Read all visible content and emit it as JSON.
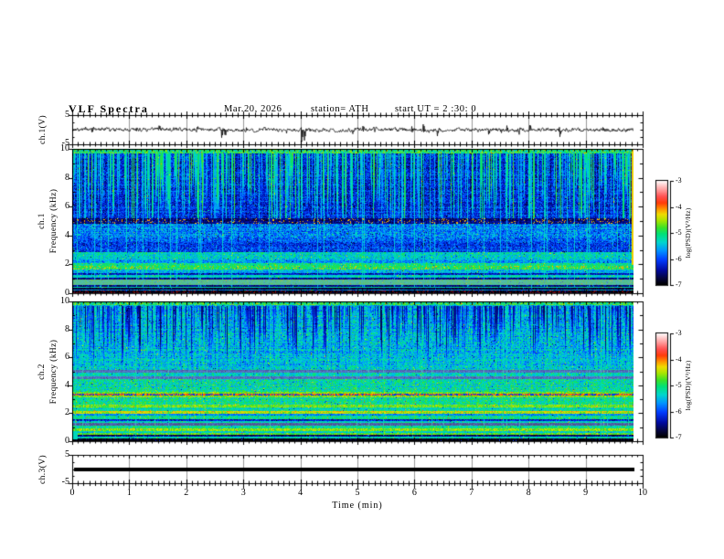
{
  "title": {
    "main": "VLF  Spectra",
    "date": "Mar.20, 2026",
    "station": "station= ATH",
    "start_ut": "start UT =  2 :30: 0"
  },
  "axes": {
    "time": {
      "label": "Time  (min)",
      "ticks": [
        "0",
        "1",
        "2",
        "3",
        "4",
        "5",
        "6",
        "7",
        "8",
        "9",
        "10"
      ],
      "range": [
        0,
        10
      ]
    },
    "ch1_wave": {
      "label": "ch.1(V)",
      "ticks": [
        "5",
        "-5"
      ],
      "range": [
        -5,
        5
      ]
    },
    "spec1": {
      "label_ch": "ch.1",
      "label_freq": "Frequency  (kHz)",
      "ticks": [
        "10",
        "8",
        "6",
        "4",
        "2",
        "0"
      ],
      "range": [
        0,
        10
      ]
    },
    "spec2": {
      "label_ch": "ch.2",
      "label_freq": "Frequency  (kHz)",
      "ticks": [
        "10",
        "8",
        "6",
        "4",
        "2",
        "0"
      ],
      "range": [
        0,
        10
      ]
    },
    "ch3_wave": {
      "label": "ch.3(V)",
      "ticks": [
        "5",
        "-5"
      ],
      "range": [
        -5,
        5
      ]
    }
  },
  "colorbar": {
    "label": "log(PSD)(V²/Hz)",
    "ticks": [
      "-3",
      "-4",
      "-5",
      "-6",
      "-7"
    ],
    "range": [
      -7,
      -3
    ]
  },
  "chart_data": {
    "type": "heatmap",
    "title": "VLF Spectra",
    "date": "Mar.20, 2026",
    "station": "ATH",
    "start_ut": "2:30:0",
    "xlabel": "Time (min)",
    "xlim": [
      0,
      10
    ],
    "data_end_min": 9.84,
    "colormap_range_log_psd": [
      -7,
      -3
    ],
    "panels": [
      {
        "id": "ch1-waveform",
        "type": "line",
        "ylabel": "ch.1(V)",
        "ylim": [
          -5,
          5
        ],
        "description": "Dense broadband noise trace centred near 0 V with impulsive spikes",
        "spikes": [
          [
            1.52,
            1.9
          ],
          [
            2.62,
            -3.1
          ],
          [
            2.68,
            -2.3
          ],
          [
            3.05,
            1.6
          ],
          [
            4.02,
            -4.4
          ],
          [
            4.07,
            -3.6
          ],
          [
            5.1,
            1.5
          ],
          [
            5.95,
            1.9
          ],
          [
            6.15,
            2.2
          ],
          [
            6.4,
            -2.0
          ],
          [
            7.3,
            -1.8
          ],
          [
            7.62,
            2.1
          ],
          [
            8.02,
            1.7
          ],
          [
            8.55,
            -1.6
          ],
          [
            9.3,
            1.4
          ]
        ]
      },
      {
        "id": "ch1-spectrogram",
        "type": "heatmap",
        "ylabel": "ch.1 Frequency (kHz)",
        "ylim": [
          0,
          10
        ],
        "zlabel": "log(PSD)(V²/Hz)",
        "zlim": [
          -7,
          -3
        ],
        "streaks": {
          "color": "green",
          "prob": 0.5,
          "zone_min_khz": 5.2,
          "min_bottom_khz": 3.0,
          "max_bottom_khz": 8.2
        },
        "bands": [
          [
            9.7,
            10.0,
            -5.05,
            0.5,
            "greenspeckle"
          ],
          [
            5.2,
            9.7,
            -6.15,
            0.4,
            ""
          ],
          [
            4.85,
            5.2,
            -6.55,
            0.25,
            "redspeckle"
          ],
          [
            3.7,
            4.85,
            -5.8,
            0.45,
            ""
          ],
          [
            2.9,
            3.7,
            -6.05,
            0.4,
            ""
          ],
          [
            2.4,
            2.9,
            -5.35,
            0.4,
            ""
          ],
          [
            2.1,
            2.4,
            -5.65,
            0.35,
            ""
          ],
          [
            1.9,
            2.1,
            -5.0,
            0.35,
            ""
          ],
          [
            1.7,
            1.9,
            -4.95,
            0.3,
            "redspeckle"
          ],
          [
            1.45,
            1.7,
            -5.45,
            0.35,
            ""
          ],
          [
            1.3,
            1.45,
            -6.3,
            0.3,
            ""
          ],
          [
            1.1,
            1.3,
            -5.35,
            0.3,
            ""
          ],
          [
            0.95,
            1.1,
            -6.5,
            0.3,
            ""
          ],
          [
            0.6,
            0.95,
            -5.15,
            0.3,
            "gray"
          ],
          [
            0.5,
            0.6,
            -6.6,
            0.25,
            ""
          ],
          [
            0.38,
            0.5,
            -5.25,
            0.3,
            ""
          ],
          [
            0.28,
            0.38,
            -6.8,
            0.2,
            ""
          ],
          [
            0.2,
            0.28,
            -5.6,
            0.3,
            ""
          ],
          [
            0.0,
            0.2,
            -7.0,
            0.2,
            "darkred"
          ]
        ],
        "features": [
          "dark-blue background 5-10 kHz with dense green vertical sferic streaks",
          "dark line with red speckles near 5 kHz",
          "green band 1.7-2.1 kHz with red speckled line",
          "pale gray band 0.6-0.95 kHz",
          "black cutoff below 0.3 kHz"
        ]
      },
      {
        "id": "ch2-spectrogram",
        "type": "heatmap",
        "ylabel": "ch.2 Frequency (kHz)",
        "ylim": [
          0,
          10
        ],
        "zlabel": "log(PSD)(V²/Hz)",
        "zlim": [
          -7,
          -3
        ],
        "streaks": {
          "color": "blue",
          "prob": 0.55,
          "zone_min_khz": 5.15,
          "min_bottom_khz": 5.3,
          "max_bottom_khz": 8.8
        },
        "bands": [
          [
            9.75,
            10.0,
            -5.0,
            0.5,
            "greenspeckle"
          ],
          [
            6.3,
            9.75,
            -5.45,
            0.45,
            ""
          ],
          [
            5.15,
            6.3,
            -5.4,
            0.4,
            ""
          ],
          [
            4.95,
            5.15,
            -6.15,
            0.3,
            "gray"
          ],
          [
            4.7,
            4.95,
            -5.25,
            0.35,
            ""
          ],
          [
            4.5,
            4.7,
            -6.05,
            0.3,
            "gray"
          ],
          [
            3.55,
            4.5,
            -5.25,
            0.45,
            ""
          ],
          [
            3.42,
            3.55,
            -4.6,
            0.3,
            ""
          ],
          [
            3.3,
            3.42,
            -4.05,
            0.3,
            "dottedred"
          ],
          [
            3.18,
            3.3,
            -4.65,
            0.3,
            ""
          ],
          [
            2.62,
            3.18,
            -5.15,
            0.4,
            ""
          ],
          [
            2.42,
            2.62,
            -4.7,
            0.3,
            ""
          ],
          [
            2.22,
            2.42,
            -5.25,
            0.35,
            ""
          ],
          [
            2.0,
            2.22,
            -4.45,
            0.3,
            "orangespeckle"
          ],
          [
            1.85,
            2.0,
            -5.85,
            0.3,
            ""
          ],
          [
            1.6,
            1.85,
            -5.15,
            0.35,
            ""
          ],
          [
            1.45,
            1.6,
            -6.3,
            0.3,
            ""
          ],
          [
            1.32,
            1.45,
            -5.3,
            0.3,
            ""
          ],
          [
            1.15,
            1.32,
            -6.35,
            0.3,
            "gray"
          ],
          [
            0.95,
            1.15,
            -5.15,
            0.35,
            ""
          ],
          [
            0.78,
            0.95,
            -4.6,
            0.3,
            ""
          ],
          [
            0.65,
            0.78,
            -5.35,
            0.3,
            ""
          ],
          [
            0.48,
            0.65,
            -4.75,
            0.3,
            ""
          ],
          [
            0.36,
            0.48,
            -6.6,
            0.25,
            ""
          ],
          [
            0.26,
            0.36,
            -5.3,
            0.3,
            ""
          ],
          [
            0.13,
            0.26,
            -6.85,
            0.2,
            ""
          ],
          [
            0.0,
            0.13,
            -7.0,
            0.15,
            ""
          ]
        ],
        "features": [
          "green/cyan background with dark-blue vertical sferic streaks 5-10 kHz",
          "strong dotted red spectral line near 3.35 kHz with yellow fringes",
          "yellow band near 2.1 kHz",
          "yellow-green bands near 0.5-0.9 kHz",
          "black cutoff below 0.25 kHz"
        ]
      },
      {
        "id": "ch3-waveform",
        "type": "line",
        "ylabel": "ch.3(V)",
        "ylim": [
          -5,
          5
        ],
        "description": "Flat thick line at 0 V for the whole record (no signal)"
      }
    ],
    "colorbar": {
      "label": "log(PSD)(V²/Hz)",
      "ticks": [
        -3,
        -4,
        -5,
        -6,
        -7
      ]
    },
    "legend": "none",
    "grid": "minute gridlines in voltage panels"
  }
}
